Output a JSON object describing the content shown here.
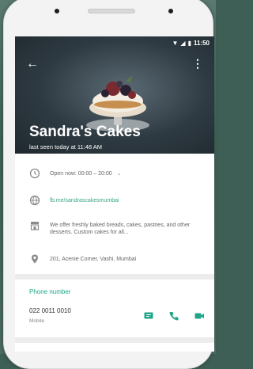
{
  "status_bar": {
    "time": "11:50"
  },
  "header": {
    "business_name": "Sandra's Cakes",
    "last_seen": "last seen today at 11:48 AM"
  },
  "info": {
    "hours": "Open now: 00:00 – 20:00",
    "link": "fb.me/sandrascakesmumbai",
    "description": "We offer freshly baked breads, cakes, pastries, and other desserts. Custom cakes for all...",
    "address": "201, Acenie Corner, Vashi, Mumbai"
  },
  "phone": {
    "section_title": "Phone number",
    "number": "022 0011 0010",
    "label": "Mobile"
  },
  "colors": {
    "accent": "#1fa688",
    "header_bg": "#2e3a42"
  },
  "icons": [
    "back-arrow-icon",
    "more-vert-icon",
    "clock-icon",
    "globe-icon",
    "store-icon",
    "location-pin-icon",
    "message-icon",
    "phone-icon",
    "video-icon"
  ]
}
